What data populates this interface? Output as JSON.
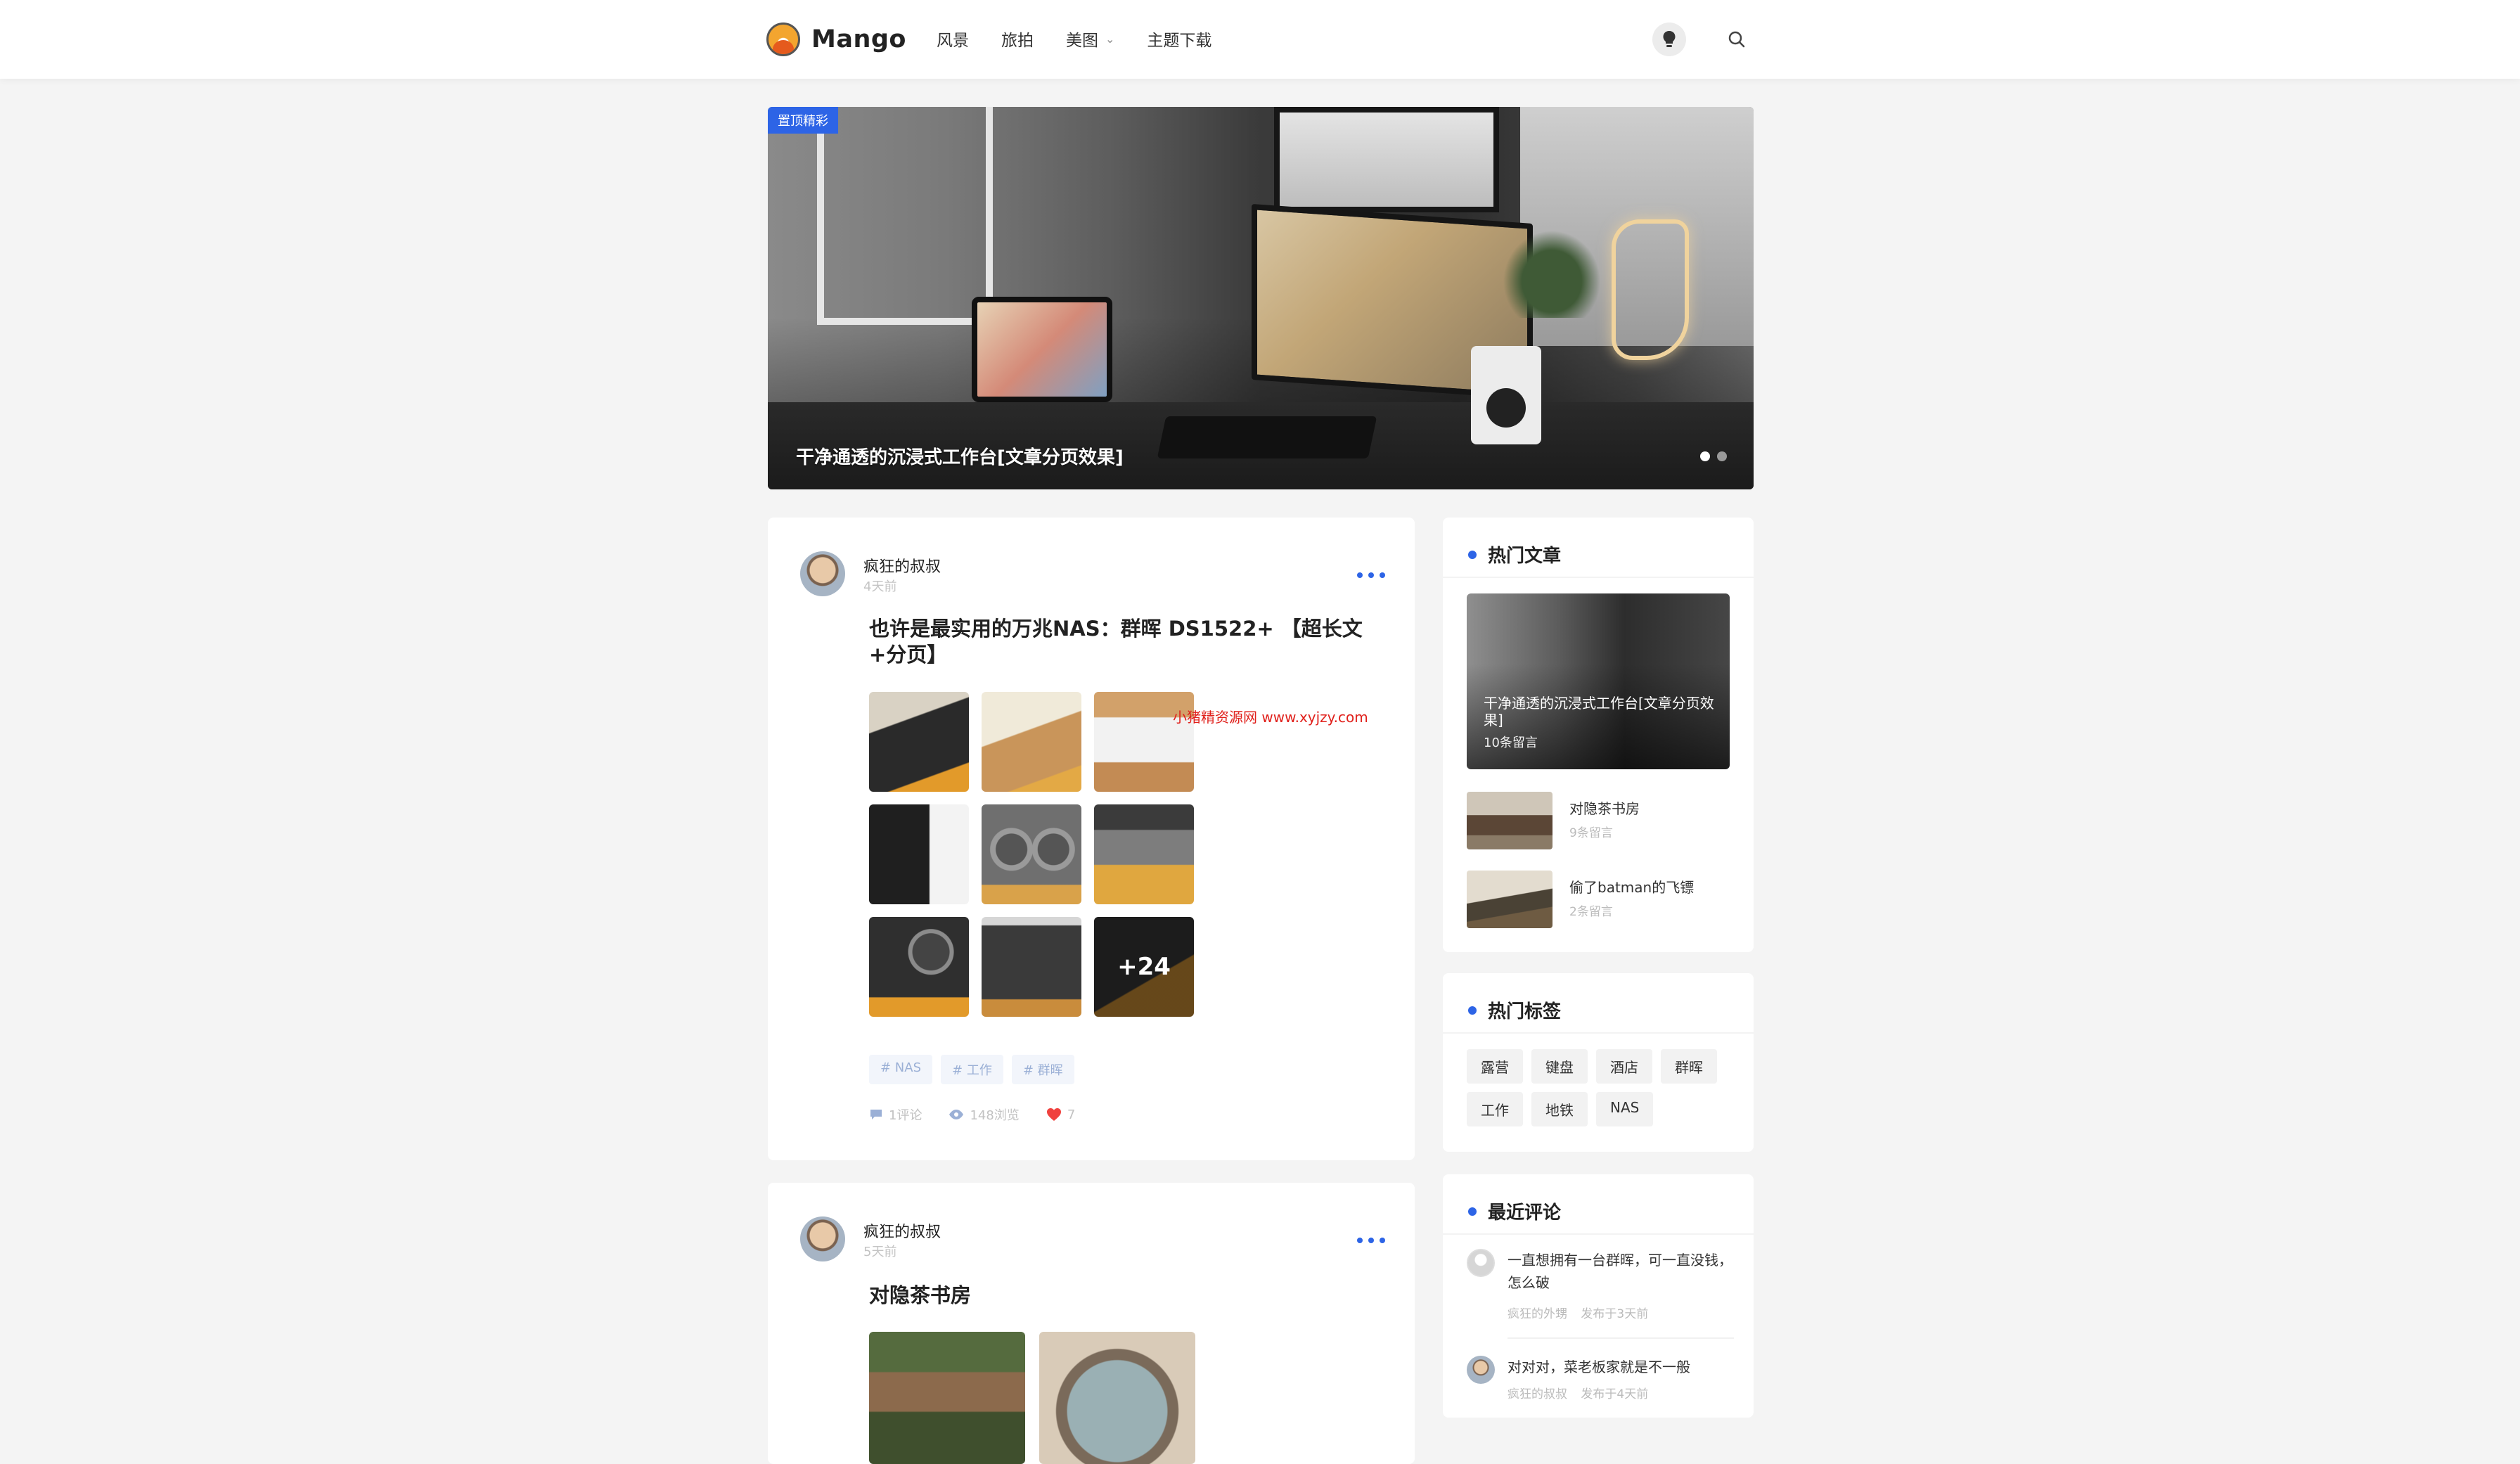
{
  "header": {
    "logo_text": "Mango",
    "nav": [
      {
        "label": "风景"
      },
      {
        "label": "旅拍"
      },
      {
        "label": "美图"
      },
      {
        "label": "主题下载"
      }
    ]
  },
  "hero": {
    "badge": "置顶精彩",
    "title": "干净通透的沉浸式工作台[文章分页效果]",
    "slide_count": 2,
    "active_slide": 1
  },
  "posts": [
    {
      "author": "疯狂的叔叔",
      "time": "4天前",
      "title": "也许是最实用的万兆NAS：群晖 DS1522+ 【超长文+分页】",
      "more_images": "+24",
      "watermark": "小猪精资源网 www.xyjzy.com",
      "tags": [
        "# NAS",
        "# 工作",
        "# 群晖"
      ],
      "comments": "1评论",
      "views": "148浏览",
      "likes": "7"
    },
    {
      "author": "疯狂的叔叔",
      "time": "5天前",
      "title": "对隐茶书房"
    }
  ],
  "sidebar": {
    "hot_articles": {
      "title": "热门文章",
      "featured": {
        "title": "干净通透的沉浸式工作台[文章分页效果]",
        "comments": "10条留言"
      },
      "items": [
        {
          "title": "对隐茶书房",
          "comments": "9条留言"
        },
        {
          "title": "偷了batman的飞镖",
          "comments": "2条留言"
        }
      ]
    },
    "hot_tags": {
      "title": "热门标签",
      "tags": [
        "露营",
        "键盘",
        "酒店",
        "群晖",
        "工作",
        "地铁",
        "NAS"
      ]
    },
    "recent_comments": {
      "title": "最近评论",
      "items": [
        {
          "text": "一直想拥有一台群晖，可一直没钱，怎么破",
          "author": "疯狂的外甥",
          "time": "发布于3天前"
        },
        {
          "text": "对对对，菜老板家就是不一般",
          "author": "疯狂的叔叔",
          "time": "发布于4天前"
        }
      ]
    }
  }
}
